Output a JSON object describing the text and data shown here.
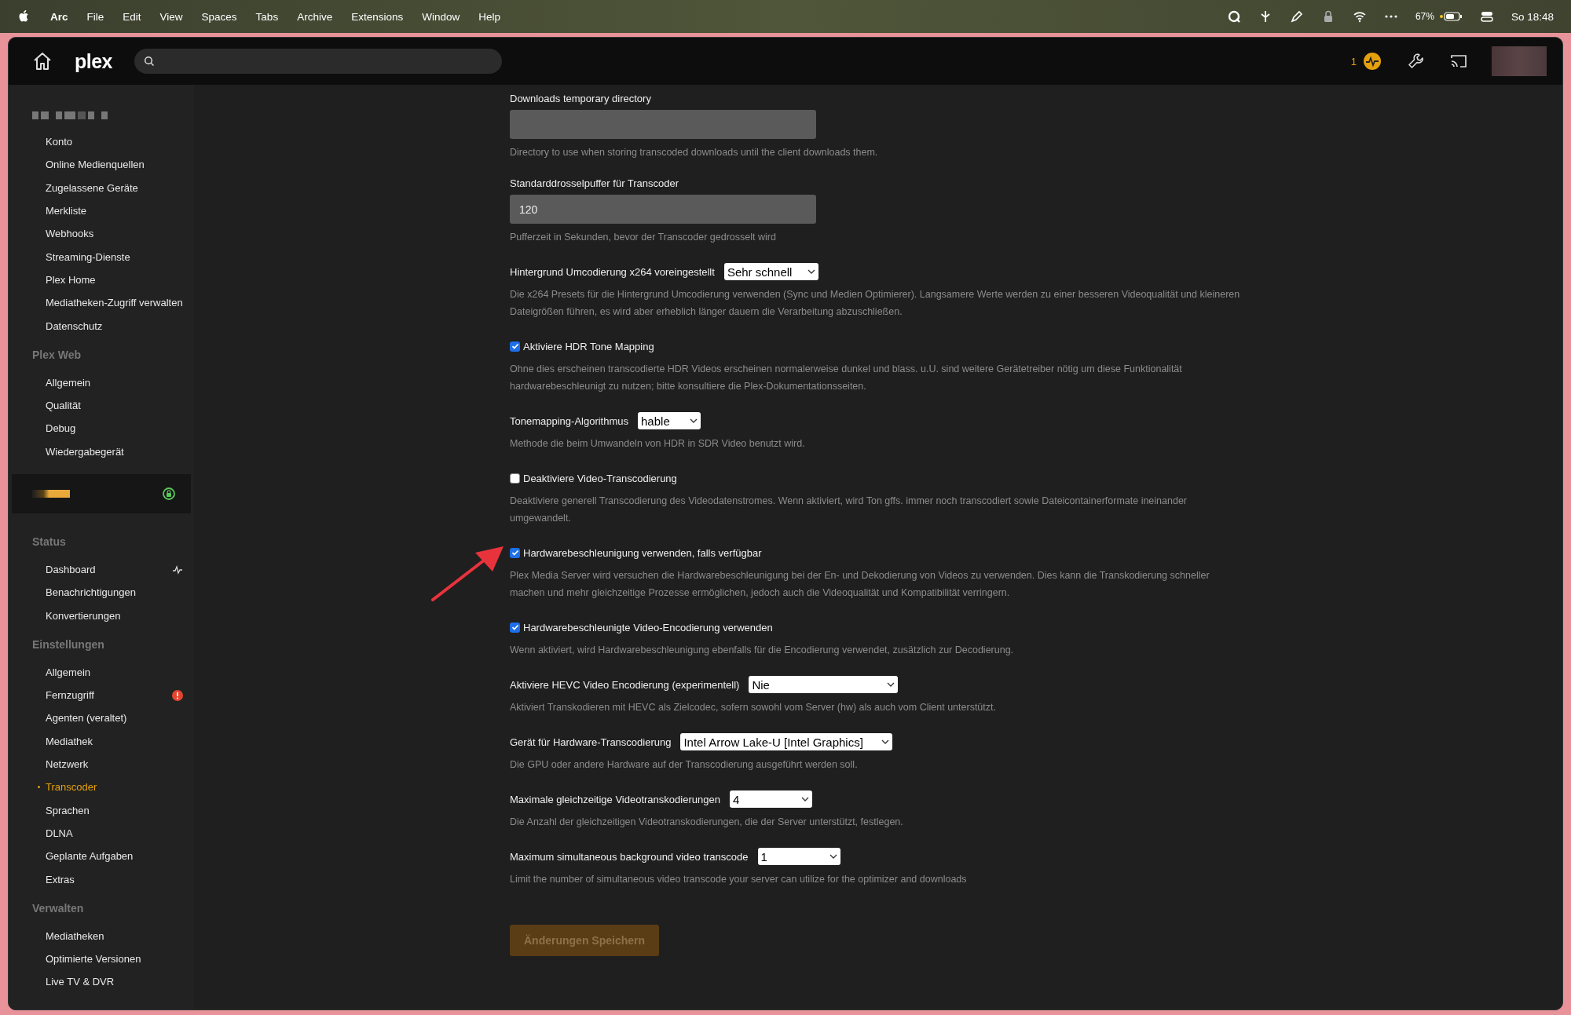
{
  "menubar": {
    "app": "Arc",
    "items": [
      "File",
      "Edit",
      "View",
      "Spaces",
      "Tabs",
      "Archive",
      "Extensions",
      "Window",
      "Help"
    ],
    "battery": "67%",
    "clock": "So 18:48"
  },
  "header": {
    "logo": "plex",
    "activity_count": "1"
  },
  "sidebar": {
    "sections": [
      {
        "kind": "group",
        "title_redacted": true,
        "items": [
          {
            "kind": "plain",
            "label": "Konto",
            "selected": false
          },
          {
            "kind": "plain",
            "label": "Online Medienquellen",
            "selected": false
          },
          {
            "kind": "plain",
            "label": "Zugelassene Geräte",
            "selected": false
          },
          {
            "kind": "plain",
            "label": "Merkliste",
            "selected": false
          },
          {
            "kind": "plain",
            "label": "Webhooks",
            "selected": false
          },
          {
            "kind": "plain",
            "label": "Streaming-Dienste",
            "selected": false
          },
          {
            "kind": "plain",
            "label": "Plex Home",
            "selected": false
          },
          {
            "kind": "plain",
            "label": "Mediatheken-Zugriff verwalten",
            "selected": false
          },
          {
            "kind": "plain",
            "label": "Datenschutz",
            "selected": false
          }
        ]
      },
      {
        "kind": "group",
        "title": "Plex Web",
        "items": [
          {
            "kind": "plain",
            "label": "Allgemein",
            "selected": false
          },
          {
            "kind": "plain",
            "label": "Qualität",
            "selected": false
          },
          {
            "kind": "plain",
            "label": "Debug",
            "selected": false
          },
          {
            "kind": "plain",
            "label": "Wiedergabegerät",
            "selected": false
          }
        ]
      },
      {
        "kind": "server",
        "secure": true
      },
      {
        "kind": "group",
        "title": "Status",
        "items": [
          {
            "kind": "activity",
            "label": "Dashboard",
            "selected": false
          },
          {
            "kind": "plain",
            "label": "Benachrichtigungen",
            "selected": false
          },
          {
            "kind": "plain",
            "label": "Konvertierungen",
            "selected": false
          }
        ]
      },
      {
        "kind": "group",
        "title": "Einstellungen",
        "items": [
          {
            "kind": "plain",
            "label": "Allgemein",
            "selected": false
          },
          {
            "kind": "alert",
            "label": "Fernzugriff",
            "selected": false
          },
          {
            "kind": "plain",
            "label": "Agenten (veraltet)",
            "selected": false
          },
          {
            "kind": "plain",
            "label": "Mediathek",
            "selected": false
          },
          {
            "kind": "plain",
            "label": "Netzwerk",
            "selected": false
          },
          {
            "kind": "plain",
            "label": "Transcoder",
            "selected": true
          },
          {
            "kind": "plain",
            "label": "Sprachen",
            "selected": false
          },
          {
            "kind": "plain",
            "label": "DLNA",
            "selected": false
          },
          {
            "kind": "plain",
            "label": "Geplante Aufgaben",
            "selected": false
          },
          {
            "kind": "plain",
            "label": "Extras",
            "selected": false
          }
        ]
      },
      {
        "kind": "group",
        "title": "Verwalten",
        "items": [
          {
            "kind": "plain",
            "label": "Mediatheken",
            "selected": false
          },
          {
            "kind": "plain",
            "label": "Optimierte Versionen",
            "selected": false
          },
          {
            "kind": "plain",
            "label": "Live TV & DVR",
            "selected": false
          }
        ]
      }
    ]
  },
  "settings": [
    {
      "kind": "text",
      "label": "Downloads temporary directory",
      "description": "Directory to use when storing transcoded downloads until the client downloads them.",
      "annotated": false
    },
    {
      "kind": "text",
      "label": "Standarddrosselpuffer für Transcoder",
      "value": "120",
      "description": "Pufferzeit in Sekunden, bevor der Transcoder gedrosselt wird",
      "annotated": false
    },
    {
      "kind": "select",
      "label": "Hintergrund Umcodierung x264 voreingestellt",
      "value": "Sehr schnell",
      "description": "Die x264 Presets für die Hintergrund Umcodierung verwenden (Sync und Medien Optimierer). Langsamere Werte werden zu einer besseren Videoqualität und kleineren Dateigrößen führen, es wird aber erheblich länger dauern die Verarbeitung abzuschließen.",
      "annotated": false
    },
    {
      "kind": "checkbox",
      "label": "Aktiviere HDR Tone Mapping",
      "checked": true,
      "description": "Ohne dies erscheinen transcodierte HDR Videos erscheinen normalerweise dunkel und blass. u.U. sind weitere Gerätetreiber nötig um diese Funktionalität hardwarebeschleunigt zu nutzen; bitte konsultiere die Plex-Dokumentationsseiten.",
      "annotated": false
    },
    {
      "kind": "select",
      "label": "Tonemapping-Algorithmus",
      "value": "hable",
      "description": "Methode die beim Umwandeln von HDR in SDR Video benutzt wird.",
      "annotated": false
    },
    {
      "kind": "checkbox",
      "label": "Deaktiviere Video-Transcodierung",
      "checked": false,
      "description": "Deaktiviere generell Transcodierung des Videodatenstromes. Wenn aktiviert, wird Ton gffs. immer noch transcodiert sowie Dateicontainerformate ineinander umgewandelt.",
      "annotated": false
    },
    {
      "kind": "checkbox",
      "label": "Hardwarebeschleunigung verwenden, falls verfügbar",
      "checked": true,
      "description": "Plex Media Server wird versuchen die Hardwarebeschleunigung bei der En- und Dekodierung von Videos zu verwenden. Dies kann die Transkodierung schneller machen und mehr gleichzeitige Prozesse ermöglichen, jedoch auch die Videoqualität und Kompatibilität verringern.",
      "annotated": true
    },
    {
      "kind": "checkbox",
      "label": "Hardwarebeschleunigte Video-Encodierung verwenden",
      "checked": true,
      "description": "Wenn aktiviert, wird Hardwarebeschleunigung ebenfalls für die Encodierung verwendet, zusätzlich zur Decodierung.",
      "annotated": false
    },
    {
      "kind": "select",
      "label": "Aktiviere HEVC Video Encodierung (experimentell)",
      "value": "Nie",
      "description": "Aktiviert Transkodieren mit HEVC als Zielcodec, sofern sowohl vom Server (hw) als auch vom Client unterstützt.",
      "annotated": false
    },
    {
      "kind": "select",
      "label": "Gerät für Hardware-Transcodierung",
      "value": "Intel Arrow Lake-U [Intel Graphics]",
      "description": "Die GPU oder andere Hardware auf der Transcodierung ausgeführt werden soll.",
      "annotated": false
    },
    {
      "kind": "select",
      "label": "Maximale gleichzeitige Videotranskodierungen",
      "value": "4",
      "description": "Die Anzahl der gleichzeitigen Videotranskodierungen, die der Server unterstützt, festlegen.",
      "annotated": false
    },
    {
      "kind": "select",
      "label": "Maximum simultaneous background video transcode",
      "value": "1",
      "description": "Limit the number of simultaneous video transcode your server can utilize for the optimizer and downloads",
      "annotated": false
    }
  ],
  "save_button": {
    "label": "Änderungen Speichern",
    "disabled": true
  }
}
